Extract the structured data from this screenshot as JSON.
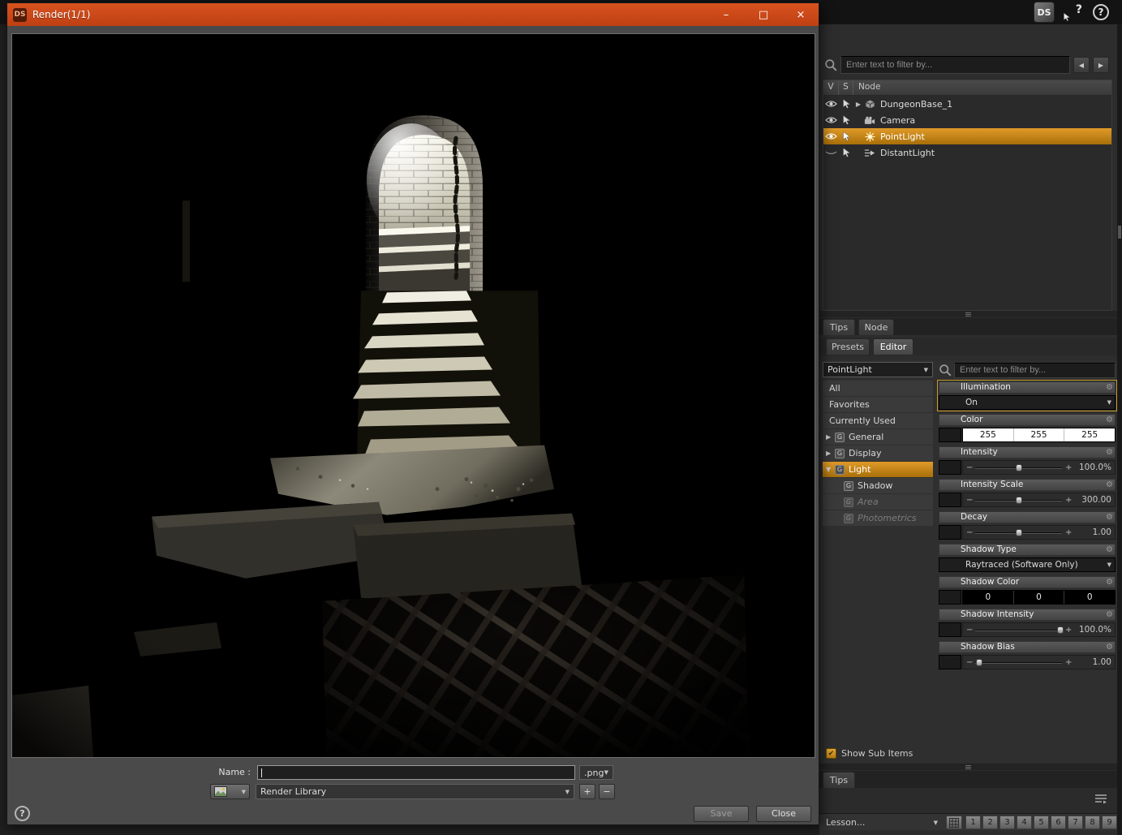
{
  "icons": {
    "dropdown": "▼",
    "expander_closed": "▶",
    "expander_open": "▼",
    "nav_left": "◀",
    "nav_right": "▶",
    "window_minimize": "–",
    "window_maximize": "□",
    "window_close": "×",
    "plus": "+",
    "minus": "−",
    "gear": "⚙",
    "check": "✔",
    "group_badge": "G",
    "grip": "≡"
  },
  "colors": {
    "titlebar_orange": "#d8531f",
    "selection_gold": "#c98a1b"
  },
  "top_bar": {
    "ds_logo": "DS",
    "whats_this_icon": "?",
    "help_icon": "?"
  },
  "render_window": {
    "title": "Render(1/1)",
    "badge": "DS",
    "name_label": "Name :",
    "name_value": "",
    "format_value": ".png",
    "library_value": "Render Library",
    "help": "?",
    "save": "Save",
    "close": "Close"
  },
  "scene_pane": {
    "filter_placeholder": "Enter text to filter by...",
    "col_v": "V",
    "col_s": "S",
    "col_node": "Node",
    "nodes": [
      {
        "label": "DungeonBase_1"
      },
      {
        "label": "Camera"
      },
      {
        "label": "PointLight"
      },
      {
        "label": "DistantLight"
      }
    ]
  },
  "tab_groups": {
    "tips": "Tips",
    "node": "Node",
    "presets": "Presets",
    "editor": "Editor"
  },
  "editor_pane": {
    "node_selector": "PointLight",
    "filter_placeholder": "Enter text to filter by...",
    "categories": {
      "all": "All",
      "favorites": "Favorites",
      "currently_used": "Currently Used",
      "general": "General",
      "display": "Display",
      "light": "Light",
      "shadow": "Shadow",
      "area": "Area",
      "photometrics": "Photometrics"
    },
    "properties": {
      "illumination": {
        "label": "Illumination",
        "value": "On"
      },
      "color": {
        "label": "Color",
        "r": "255",
        "g": "255",
        "b": "255",
        "swatch": "#ffffff"
      },
      "intensity": {
        "label": "Intensity",
        "value": "100.0%",
        "pos": 50
      },
      "intensity_scale": {
        "label": "Intensity Scale",
        "value": "300.00",
        "pos": 50
      },
      "decay": {
        "label": "Decay",
        "value": "1.00",
        "pos": 50
      },
      "shadow_type": {
        "label": "Shadow Type",
        "value": "Raytraced (Software Only)"
      },
      "shadow_color": {
        "label": "Shadow Color",
        "r": "0",
        "g": "0",
        "b": "0",
        "swatch": "#000000"
      },
      "shadow_intensity": {
        "label": "Shadow Intensity",
        "value": "100.0%",
        "pos": 98
      },
      "shadow_bias": {
        "label": "Shadow Bias",
        "value": "1.00",
        "pos": 5
      }
    },
    "show_sub_items": "Show Sub Items"
  },
  "bottom_bar": {
    "tips_tab": "Tips",
    "lesson": "Lesson...",
    "pages": [
      "1",
      "2",
      "3",
      "4",
      "5",
      "6",
      "7",
      "8",
      "9"
    ]
  }
}
